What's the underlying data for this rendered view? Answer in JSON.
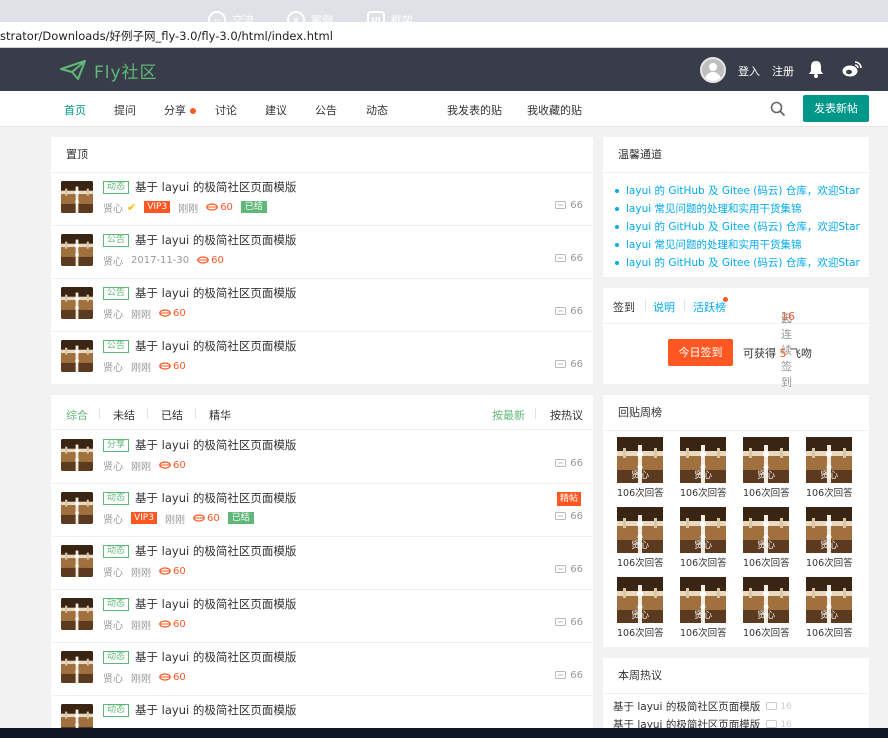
{
  "browser": {
    "address": "strator/Downloads/好例子网_fly-3.0/fly-3.0/html/index.html"
  },
  "header": {
    "logo_text": "Fly社区",
    "nav": [
      {
        "label": "交流",
        "icon": "chat-icon"
      },
      {
        "label": "案例",
        "icon": "case-icon"
      },
      {
        "label": "框架",
        "icon": "ui-icon"
      }
    ],
    "login": "登入",
    "register": "注册"
  },
  "subnav": {
    "items": [
      "首页",
      "提问",
      "分享",
      "讨论",
      "建议",
      "公告",
      "动态"
    ],
    "my_posts": "我发表的贴",
    "my_fav": "我收藏的贴",
    "post_button": "发表新帖"
  },
  "top_panel": {
    "title": "置顶",
    "rows": [
      {
        "tag": "动态",
        "title": "基于 layui 的极简社区页面模版",
        "user": "贤心",
        "vip": "VIP3",
        "time": "刚刚",
        "kiss": "60",
        "status": "已结",
        "replies": "66"
      },
      {
        "tag": "公告",
        "title": "基于 layui 的极简社区页面模版",
        "user": "贤心",
        "time": "2017-11-30",
        "kiss": "60",
        "replies": "66"
      },
      {
        "tag": "公告",
        "title": "基于 layui 的极简社区页面模版",
        "user": "贤心",
        "time": "刚刚",
        "kiss": "60",
        "replies": "66"
      },
      {
        "tag": "公告",
        "title": "基于 layui 的极简社区页面模版",
        "user": "贤心",
        "time": "刚刚",
        "kiss": "60",
        "replies": "66"
      }
    ]
  },
  "list_panel": {
    "filters": [
      "综合",
      "未结",
      "已结",
      "精华"
    ],
    "sort_new": "按最新",
    "sort_hot": "按热议",
    "rows": [
      {
        "tag": "分享",
        "title": "基于 layui 的极简社区页面模版",
        "user": "贤心",
        "time": "刚刚",
        "kiss": "60",
        "replies": "66"
      },
      {
        "tag": "动态",
        "title": "基于 layui 的极简社区页面模版",
        "user": "贤心",
        "vip": "VIP3",
        "time": "刚刚",
        "kiss": "60",
        "status": "已结",
        "badge": "精帖",
        "replies": "66"
      },
      {
        "tag": "动态",
        "title": "基于 layui 的极简社区页面模版",
        "user": "贤心",
        "time": "刚刚",
        "kiss": "60",
        "replies": "66"
      },
      {
        "tag": "动态",
        "title": "基于 layui 的极简社区页面模版",
        "user": "贤心",
        "time": "刚刚",
        "kiss": "60",
        "replies": "66"
      },
      {
        "tag": "动态",
        "title": "基于 layui 的极简社区页面模版",
        "user": "贤心",
        "time": "刚刚",
        "kiss": "60",
        "replies": "66"
      },
      {
        "tag": "动态",
        "title": "基于 layui 的极简社区页面模版"
      }
    ]
  },
  "notice": {
    "title": "温馨通道",
    "links": [
      "layui 的 GitHub 及 Gitee (码云) 仓库，欢迎Star",
      "layui 常见问题的处理和实用干货集锦",
      "layui 的 GitHub 及 Gitee (码云) 仓库，欢迎Star",
      "layui 常见问题的处理和实用干货集锦",
      "layui 的 GitHub 及 Gitee (码云) 仓库，欢迎Star"
    ]
  },
  "sign": {
    "tab_sign": "签到",
    "tab_help": "说明",
    "tab_rank": "活跃榜",
    "streak_pre": "已连续签到",
    "streak_days": "16",
    "streak_post": "天",
    "button": "今日签到",
    "reward_pre": "可获得",
    "reward_num": "5",
    "reward_post": "飞吻"
  },
  "rank": {
    "title": "回贴周榜",
    "name": "贤心",
    "count": "106次回答"
  },
  "hot": {
    "title": "本周热议",
    "items": [
      {
        "title": "基于 layui 的极简社区页面模版",
        "count": "16"
      },
      {
        "title": "基于 layui 的极简社区页面模版",
        "count": "16"
      }
    ]
  },
  "colors": {
    "header_bg": "#393d49",
    "accent": "#009688",
    "green": "#5FB878",
    "orange": "#FF5722",
    "link": "#01AAED"
  }
}
